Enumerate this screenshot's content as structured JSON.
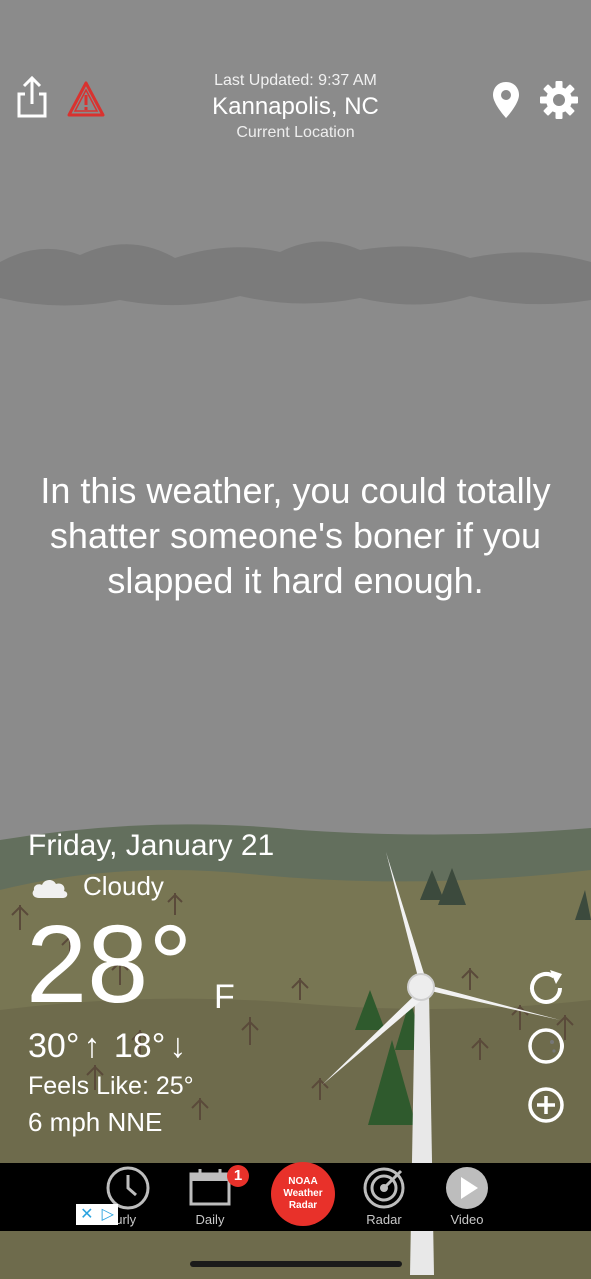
{
  "header": {
    "last_updated": "Last Updated: 9:37 AM",
    "city": "Kannapolis, NC",
    "location_label": "Current Location",
    "icons": [
      "share-icon",
      "alert-icon",
      "location-pin-icon",
      "gear-icon"
    ]
  },
  "message": "In this weather, you could totally shatter someone's boner if you slapped it hard enough.",
  "weather": {
    "date": "Friday, January 21",
    "condition": "Cloudy",
    "condition_icon": "cloud-icon",
    "temperature": "28°",
    "unit": "F",
    "high": "30°",
    "low": "18°",
    "feels_like": "Feels Like: 25°",
    "wind": "6 mph NNE"
  },
  "side_buttons": [
    "refresh-icon",
    "moon-icon",
    "add-icon"
  ],
  "tabs": {
    "hourly": "ourly",
    "daily": "Daily",
    "daily_badge": "1",
    "noaa": [
      "NOAA",
      "Weather",
      "Radar"
    ],
    "radar": "Radar",
    "video": "Video"
  },
  "ad": {
    "close": "✕",
    "play": "▷"
  },
  "colors": {
    "sky": "#8a8a8a",
    "hills": "#5f6b55",
    "field": "#777553",
    "noaa_red": "#e8312a",
    "alert_red": "#d9322f"
  }
}
